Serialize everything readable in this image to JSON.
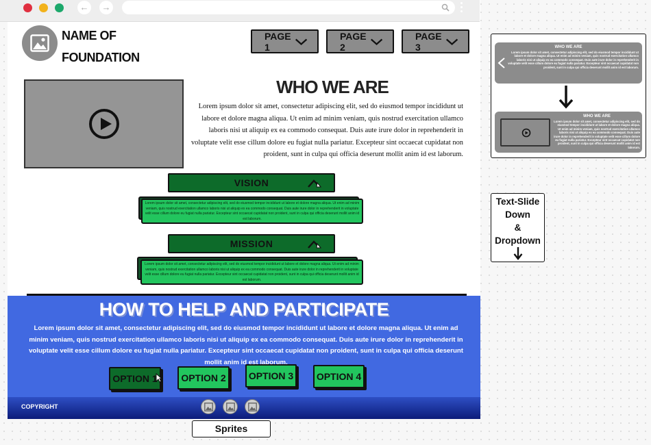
{
  "browser": {
    "traffic_lights": [
      "#e03040",
      "#f2b21b",
      "#1ca86b"
    ]
  },
  "header": {
    "brand_line1": "NAME OF",
    "brand_line2": "FOUNDATION",
    "nav": [
      {
        "label": "PAGE 1"
      },
      {
        "label": "PAGE 2"
      },
      {
        "label": "PAGE 3"
      }
    ]
  },
  "who": {
    "title": "WHO WE ARE",
    "body": "Lorem ipsum dolor sit amet, consectetur adipiscing elit, sed do eiusmod tempor incididunt ut labore et dolore magna aliqua. Ut enim ad minim veniam, quis nostrud exercitation ullamco laboris nisi ut aliquip ex ea commodo consequat. Duis aute irure dolor in reprehenderit in voluptate velit esse cillum dolore eu fugiat nulla pariatur. Excepteur sint occaecat cupidatat non proident, sunt in culpa qui officia deserunt mollit anim id est laborum."
  },
  "accordion": [
    {
      "label": "VISION",
      "body": "Lorem ipsum dolor sit amet, consectetur adipiscing elit, sed do eiusmod tempor incididunt ut labore et dolore magna aliqua. Ut enim ad minim veniam, quis nostrud exercitation ullamco laboris nisi ut aliquip ex ea commodo consequat. Duis aute irure dolor in reprehenderit in voluptate velit esse cillum dolore eu fugiat nulla pariatur. Excepteur sint occaecat cupidatat non proident, sunt in culpa qui officia deserunt mollit anim id est laborum."
    },
    {
      "label": "MISSION",
      "body": "Lorem ipsum dolor sit amet, consectetur adipiscing elit, sed do eiusmod tempor incididunt ut labore et dolore magna aliqua. Ut enim ad minim veniam, quis nostrud exercitation ullamco laboris nisi ut aliquip ex ea commodo consequat. Duis aute irure dolor in reprehenderit in voluptate velit esse cillum dolore eu fugiat nulla pariatur. Excepteur sint occaecat cupidatat non proident, sunt in culpa qui officia deserunt mollit anim id est laborum."
    }
  ],
  "help": {
    "title": "HOW TO HELP AND PARTICIPATE",
    "body": "Lorem ipsum dolor sit amet, consectetur adipiscing elit, sed do eiusmod tempor incididunt ut labore et dolore magna aliqua. Ut enim ad minim veniam, quis nostrud exercitation ullamco laboris nisi ut aliquip ex ea commodo consequat. Duis aute irure dolor in reprehenderit in voluptate velit esse cillum dolore eu fugiat nulla pariatur. Excepteur sint occaecat cupidatat non proident, sunt in culpa qui officia deserunt mollit anim id est laborum.",
    "options": [
      "OPTION 1",
      "OPTION 2",
      "OPTION 3",
      "OPTION 4"
    ],
    "copyright": "COPYRIGHT"
  },
  "annotations": {
    "sprites": "Sprites",
    "note_lines": [
      "Text-Slide",
      "Down",
      "&",
      "Dropdown"
    ],
    "preview_title": "WHO WE ARE",
    "preview_body": "Lorem ipsum dolor sit amet, consectetur adipiscing elit, sed do eiusmod tempor incididunt ut labore et dolore magna aliqua. Ut enim ad minim veniam, quis nostrud exercitation ullamco laboris nisi ut aliquip ex ea commodo consequat. Duis aute irure dolor in reprehenderit in voluptate velit esse cillum dolore eu fugiat nulla pariatur. Excepteur sint occaecat cupidatat non proident, sunt in culpa qui officia deserunt mollit anim id est laborum."
  },
  "colors": {
    "accordion_head": "#0d6b2a",
    "accordion_panel": "#22c55e",
    "help_bg": "#4169e1",
    "footer": "#0c1c7a",
    "gray": "#8c8c8c"
  }
}
